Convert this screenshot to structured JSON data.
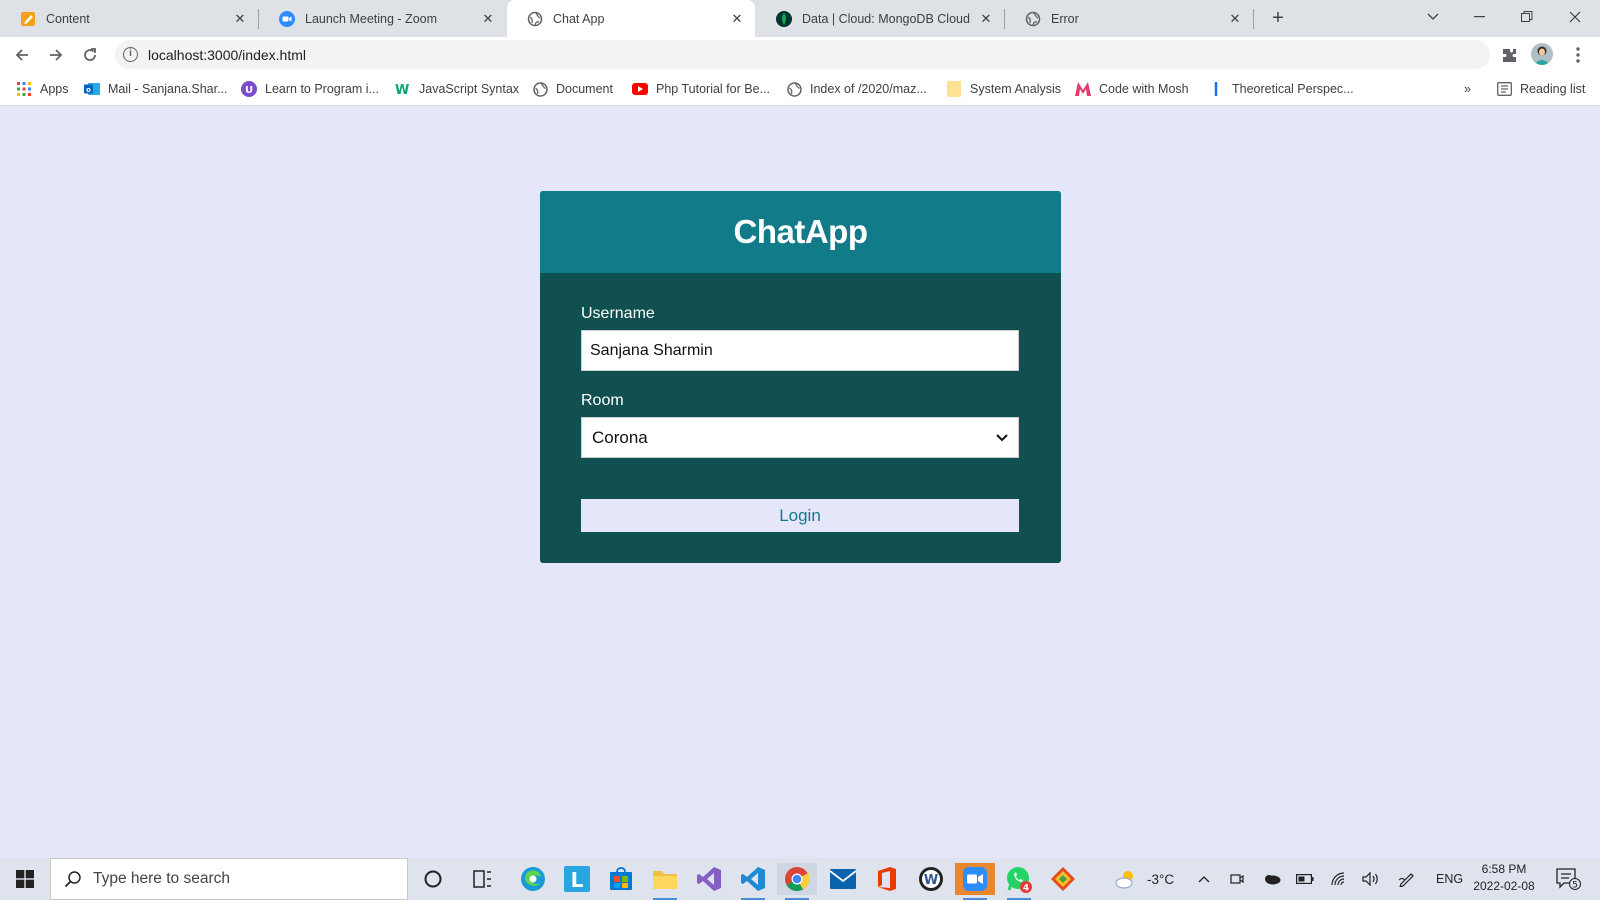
{
  "browser": {
    "tabs": [
      {
        "title": "Content",
        "icon": "content-icon"
      },
      {
        "title": "Launch Meeting - Zoom",
        "icon": "zoom-icon"
      },
      {
        "title": "Chat App",
        "icon": "globe-icon"
      },
      {
        "title": "Data | Cloud: MongoDB Cloud",
        "icon": "mongodb-icon"
      },
      {
        "title": "Error",
        "icon": "globe-icon"
      }
    ],
    "url": "localhost:3000/index.html",
    "bookmarks": [
      {
        "label": "Apps",
        "icon": "apps-grid-icon"
      },
      {
        "label": "Mail - Sanjana.Shar...",
        "icon": "outlook-icon"
      },
      {
        "label": "Learn to Program i...",
        "icon": "udacity-icon"
      },
      {
        "label": "JavaScript Syntax",
        "icon": "w3schools-icon"
      },
      {
        "label": "Document",
        "icon": "globe-icon"
      },
      {
        "label": "Php Tutorial for Be...",
        "icon": "youtube-icon"
      },
      {
        "label": "Index of /2020/maz...",
        "icon": "globe-icon"
      },
      {
        "label": "System Analysis",
        "icon": "folder-icon"
      },
      {
        "label": "Code with Mosh",
        "icon": "mosh-icon"
      },
      {
        "label": "Theoretical Perspec...",
        "icon": "bookmark-icon"
      }
    ],
    "overflow": "»",
    "reading_list": "Reading list"
  },
  "chat": {
    "title": "ChatApp",
    "username_label": "Username",
    "username_value": "Sanjana Sharmin",
    "room_label": "Room",
    "room_selected": "Corona",
    "login_label": "Login",
    "colors": {
      "header": "#117b8a",
      "body": "#105051",
      "page": "#e6e6fa"
    }
  },
  "taskbar": {
    "search_placeholder": "Type here to search",
    "weather": "-3°C",
    "language": "ENG",
    "time": "6:58 PM",
    "date": "2022-02-08",
    "whatsapp_badge": "4",
    "notification_count": "5"
  }
}
